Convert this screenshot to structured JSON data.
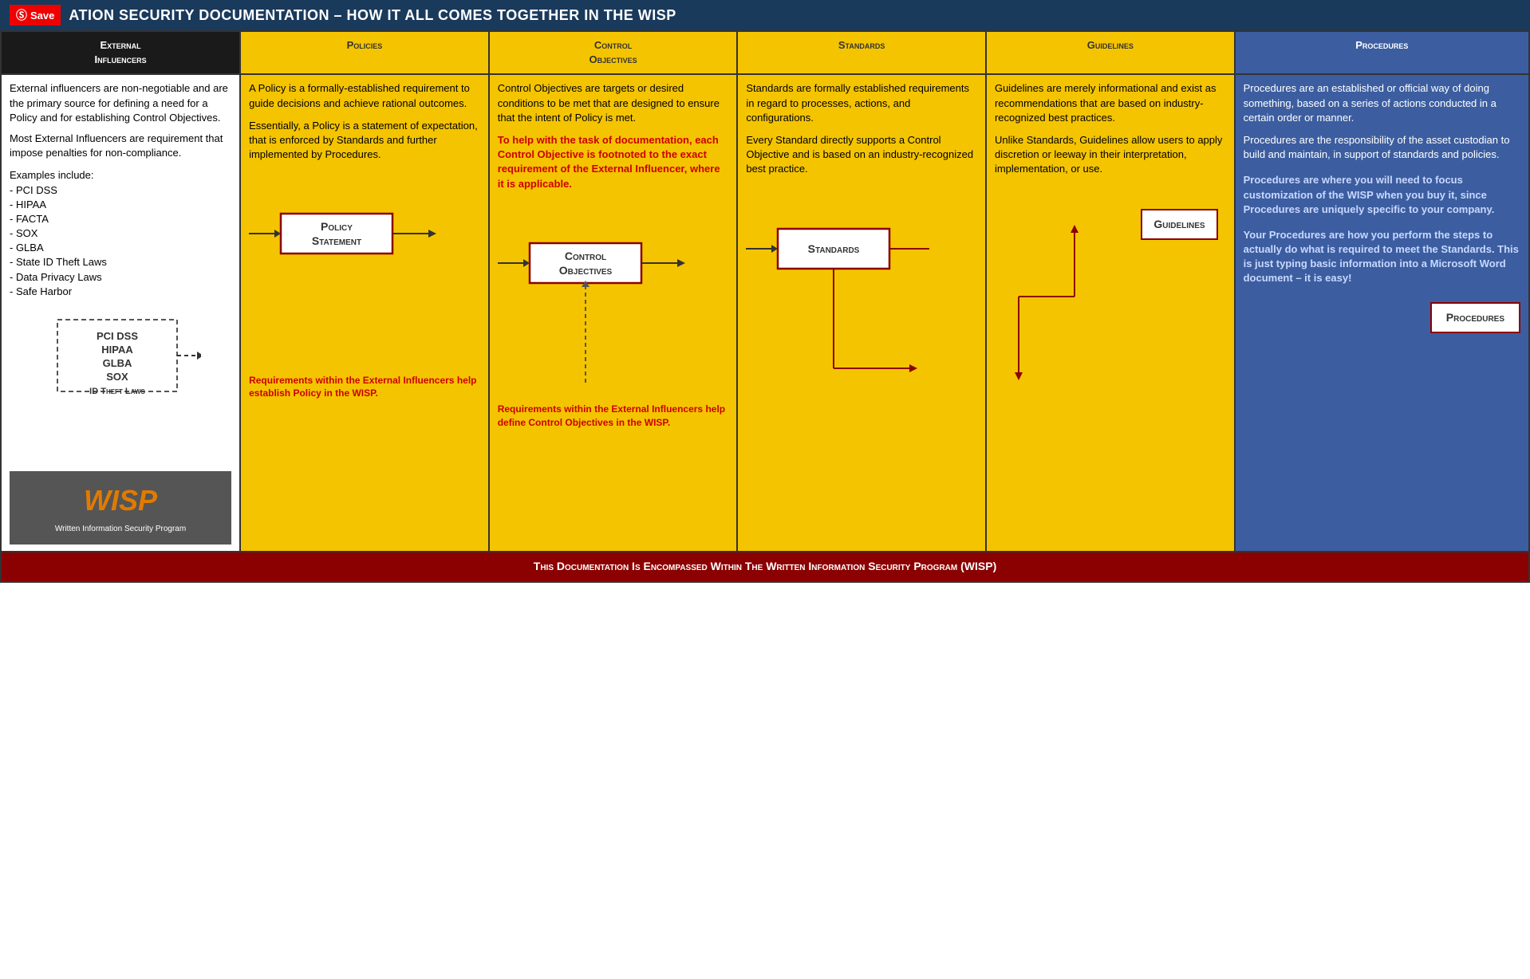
{
  "topbar": {
    "title": "ATION SECURITY DOCUMENTATION – HOW IT ALL COMES TOGETHER IN THE WISP",
    "save_label": "Save"
  },
  "headers": {
    "external": "External\nInfluencers",
    "policies": "Policies",
    "control": "Control\nObjectives",
    "standards": "Standards",
    "guidelines": "Guidelines",
    "procedures": "Procedures"
  },
  "external": {
    "desc1": "External influencers are non-negotiable and are the primary source for defining a need for a Policy and for establishing Control Objectives.",
    "desc2": "Most External Influencers are requirement that impose penalties for non-compliance.",
    "examples_label": "Examples include:",
    "examples": [
      "- PCI DSS",
      "- HIPAA",
      "- FACTA",
      "- SOX",
      "- GLBA",
      "- State ID Theft Laws",
      "- Data Privacy Laws",
      "- Safe Harbor"
    ],
    "ext_box_items": [
      "PCI DSS",
      "HIPAA",
      "GLBA",
      "SOX",
      "ID Theft Laws"
    ],
    "wisp_text": "WISP",
    "wisp_sub": "Written Information Security Program"
  },
  "policies": {
    "desc1": "A Policy is a formally-established requirement to guide decisions and achieve rational outcomes.",
    "desc2": "Essentially, a Policy is a statement of expectation, that is enforced by Standards and further implemented by Procedures.",
    "box_label": "Policy\nStatement",
    "note": "Requirements within the External Influencers help establish Policy in the WISP."
  },
  "control": {
    "desc1": "Control Objectives are targets or desired conditions to be met that are designed to ensure that the intent of Policy is met.",
    "desc2_red": "To help with the task of documentation, each Control Objective is footnoted to the exact requirement of the External Influencer, where it is applicable.",
    "box_label": "Control\nObjectives",
    "note": "Requirements within the External Influencers help define Control Objectives in the WISP."
  },
  "standards": {
    "desc1": "Standards are formally established requirements in regard to processes, actions, and configurations.",
    "desc2": "Every Standard directly supports a Control Objective and is based on an industry-recognized best practice.",
    "box_label": "Standards"
  },
  "guidelines": {
    "desc1": "Guidelines are merely informational and exist as recommendations that are based on industry-recognized best practices.",
    "desc2": "Unlike Standards, Guidelines allow users to apply discretion or leeway in their interpretation, implementation, or use.",
    "box_label": "Guidelines"
  },
  "procedures": {
    "desc1": "Procedures are an established or official way of doing something, based on a series of actions conducted in a certain order or manner.",
    "desc2": "Procedures are the responsibility of the asset custodian to build and maintain, in support of standards and policies.",
    "highlight1": "Procedures are where you will need to focus customization of the WISP when you buy it, since Procedures are uniquely specific to your company.",
    "highlight2": "Your Procedures are how you perform the steps to actually do what is required to meet the Standards. This is just typing basic information into a Microsoft Word document – it is easy!",
    "box_label": "Procedures"
  },
  "footer": {
    "text": "This Documentation Is Encompassed Within The Written Information Security Program (WISP)"
  }
}
